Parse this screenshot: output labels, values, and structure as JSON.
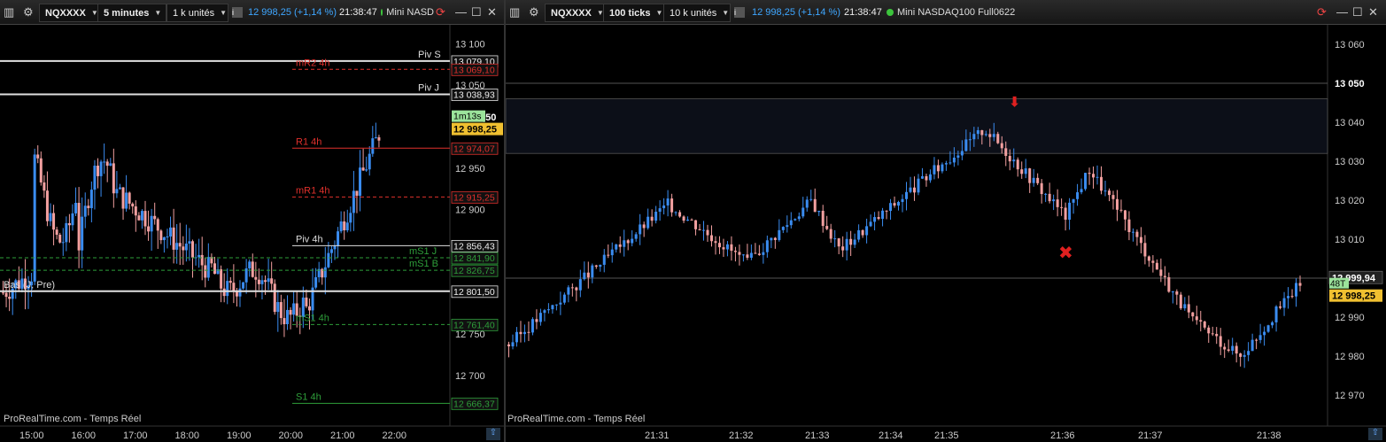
{
  "window_left": {
    "symbol": "NQXXXX",
    "interval": "5 minutes",
    "units": "1 k unités",
    "info_icon": "info-icon",
    "last_price": "12 998,25 (+1,14 %)",
    "time": "21:38:47",
    "instrument": "Mini NASD",
    "price_axis": [
      "13 100",
      "13 050",
      "12 950",
      "12 900",
      "12 750",
      "12 700"
    ],
    "time_axis": [
      "15:00",
      "16:00",
      "17:00",
      "18:00",
      "19:00",
      "20:00",
      "21:00",
      "22:00"
    ],
    "levels": [
      {
        "name": "Piv S",
        "value": "13 079,10",
        "color": "#e0e0e0",
        "style": "solid",
        "label_color": "#ddd"
      },
      {
        "name": "mR2 4h",
        "value": "13 069,10",
        "color": "#e0302c",
        "style": "dashed",
        "label_color": "#e0302c"
      },
      {
        "name": "Piv J",
        "value": "13 038,93",
        "color": "#e0e0e0",
        "style": "solid",
        "label_color": "#ddd"
      },
      {
        "name": "R1 4h",
        "value": "12 974,07",
        "color": "#e0302c",
        "style": "solid",
        "label_color": "#e0302c"
      },
      {
        "name": "mR1 4h",
        "value": "12 915,25",
        "color": "#e0302c",
        "style": "dashed",
        "label_color": "#e0302c"
      },
      {
        "name": "Piv 4h",
        "value": "12 856,43",
        "color": "#e0e0e0",
        "style": "solid",
        "label_color": "#ddd"
      },
      {
        "name": "mS1 J",
        "value": "12 841,90",
        "color": "#2e9e3a",
        "style": "dashed",
        "label_color": "#2e9e3a"
      },
      {
        "name": "mS1 B",
        "value": "12 826,75",
        "color": "#2e9e3a",
        "style": "dashed",
        "label_color": "#2e9e3a"
      },
      {
        "name": "Bas (J, Pre)",
        "value": "12 801,50",
        "color": "#e0e0e0",
        "style": "solid",
        "label_color": "#ddd"
      },
      {
        "name": "mS1 4h",
        "value": "12 761,40",
        "color": "#2e9e3a",
        "style": "dashed",
        "label_color": "#2e9e3a"
      },
      {
        "name": "S1 4h",
        "value": "12 666,37",
        "color": "#2e9e3a",
        "style": "solid",
        "label_color": "#2e9e3a"
      }
    ],
    "high_tag": "13 011,50",
    "countdown": "1m13s",
    "current_price": "12 998,25",
    "watermark": "ProRealTime.com - Temps Réel"
  },
  "window_right": {
    "symbol": "NQXXXX",
    "interval": "100 ticks",
    "units": "10 k unités",
    "last_price": "12 998,25 (+1,14 %)",
    "time": "21:38:47",
    "instrument": "Mini NASDAQ100 Full0622",
    "price_axis": [
      "13 060",
      "13 050",
      "13 040",
      "13 030",
      "13 020",
      "13 010",
      "12 990",
      "12 980",
      "12 970"
    ],
    "time_axis": [
      "21:31",
      "21:32",
      "21:33",
      "21:34",
      "21:35",
      "21:36",
      "21:37",
      "21:38"
    ],
    "tag_high": "12 999,94",
    "countdown": "48T",
    "current_price": "12 998,25",
    "watermark": "ProRealTime.com - Temps Réel"
  },
  "colors": {
    "up": "#3a8cf0",
    "down": "#f2a0a0",
    "accent": "#3ea6ff",
    "price_tag": "#f0c030",
    "timer": "#9be39b"
  }
}
